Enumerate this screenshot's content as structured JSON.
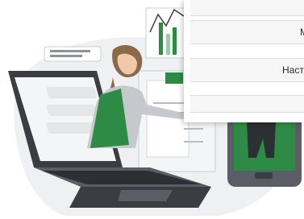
{
  "menu": {
    "items": [
      {
        "label": ""
      },
      {
        "label": "Ме"
      },
      {
        "label": "Настр"
      },
      {
        "label": ""
      }
    ]
  },
  "illustration": {
    "accent_color": "#2e8b45",
    "dark_color": "#3a3d42",
    "light_color": "#eef0f2"
  }
}
